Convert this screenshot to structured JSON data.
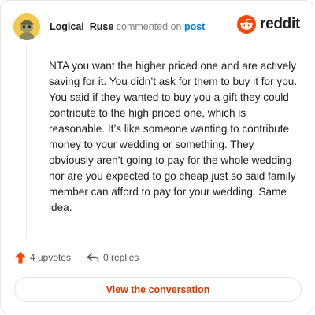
{
  "comment": {
    "username": "Logical_Ruse",
    "action_text": "commented on",
    "post_link": "post",
    "body": "NTA you want the higher priced one and are actively saving for it. You didn’t ask for them to buy it for you. You said if they wanted to buy you a gift they could contribute to the high priced one, which is reasonable. It’s like someone wanting to contribute money to your wedding or something. They obviously aren’t going to pay for the whole wedding nor are you expected to go cheap just so said family member can afford to pay for your wedding. Same idea."
  },
  "brand": {
    "wordmark": "reddit",
    "color": "#ff4500"
  },
  "stats": {
    "upvotes": "4 upvotes",
    "replies": "0 replies"
  },
  "cta": {
    "label": "View the conversation",
    "color": "#d93a00"
  },
  "icons": {
    "avatar": "snoo-avatar-icon",
    "logo": "reddit-snoo-icon",
    "upvote": "upvote-arrow-icon",
    "reply": "reply-arrow-icon"
  }
}
